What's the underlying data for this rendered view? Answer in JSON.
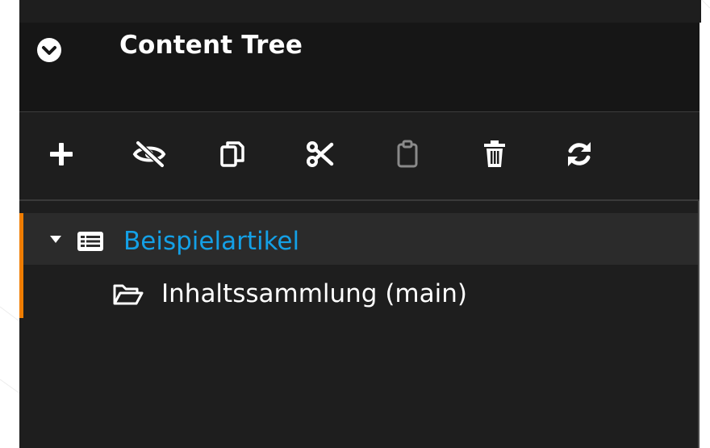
{
  "window": {
    "title": "Content Tree"
  },
  "header": {
    "collapse_icon": "chevron-down-circle-icon"
  },
  "toolbar": {
    "buttons": [
      {
        "name": "add",
        "icon": "plus-icon"
      },
      {
        "name": "hide",
        "icon": "eye-slash-icon"
      },
      {
        "name": "copy",
        "icon": "copy-icon"
      },
      {
        "name": "cut",
        "icon": "scissors-icon"
      },
      {
        "name": "paste",
        "icon": "clipboard-icon",
        "disabled": true
      },
      {
        "name": "delete",
        "icon": "trash-icon"
      },
      {
        "name": "refresh",
        "icon": "sync-icon"
      }
    ]
  },
  "tree": {
    "root": {
      "label": "Beispielartikel",
      "icon": "list-alt-icon",
      "expanded": true,
      "selected": true
    },
    "children": [
      {
        "label": "Inhaltssammlung (main)",
        "icon": "folder-open-icon"
      }
    ]
  },
  "colors": {
    "panel_bg": "#1e1e1e",
    "header_bg": "#161616",
    "selected_row_bg": "#2b2b2b",
    "accent": "#ef7d00",
    "link": "#14a0e6",
    "text": "#ffffff"
  }
}
